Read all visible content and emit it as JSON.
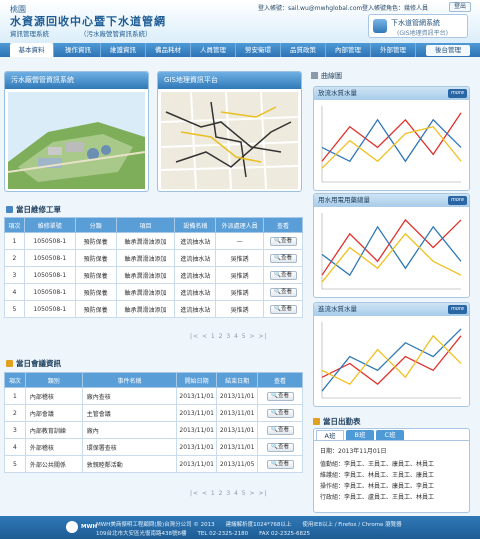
{
  "header": {
    "city": "桃園",
    "title": "水資源回收中心暨下水道管網",
    "subtitle": "資訊管理系統",
    "subtitle_en": "（污水廠營管資訊系統）",
    "login_account": "登入帳號：sail.wu@mwhglobal.com",
    "login_role": "登入帳號角色：幾修人員",
    "logout": "登出",
    "sys_badge_title": "下水道管網系統",
    "sys_badge_sub": "(GIS地理資訊平台)"
  },
  "nav": {
    "items": [
      "基本資料",
      "操作資訊",
      "維護資訊",
      "備品耗材",
      "人員管理",
      "勞安衛環",
      "品質政策",
      "內部管理",
      "外部管理"
    ],
    "right": "後台管理"
  },
  "cards": [
    {
      "title": "污水廠營管資訊系統"
    },
    {
      "title": "GIS地理資訊平台"
    }
  ],
  "repair": {
    "title": "當日維修工單",
    "headers": [
      "項次",
      "維修單號",
      "分類",
      "項目",
      "設備名稱",
      "外派處理人員",
      "查看"
    ],
    "rows": [
      [
        "1",
        "1050508-1",
        "預防保養",
        "軸承潤滑油添加",
        "進流抽水站",
        "—"
      ],
      [
        "2",
        "1050508-1",
        "預防保養",
        "軸承潤滑油添加",
        "進流抽水站",
        "吳惟誘"
      ],
      [
        "3",
        "1050508-1",
        "預防保養",
        "軸承潤滑油添加",
        "進流抽水站",
        "吳惟誘"
      ],
      [
        "4",
        "1050508-1",
        "預防保養",
        "軸承潤滑油添加",
        "進流抽水站",
        "吳惟誘"
      ],
      [
        "5",
        "1050508-1",
        "預防保養",
        "軸承潤滑油添加",
        "進流抽水站",
        "吳惟誘"
      ]
    ],
    "view_label": "查看",
    "pager": "|< < 1 2 3 4 5 > >|"
  },
  "meeting": {
    "title": "當日會議資訊",
    "headers": [
      "項次",
      "類別",
      "事件名稱",
      "開始日期",
      "結束日期",
      "查看"
    ],
    "rows": [
      [
        "1",
        "內部稽核",
        "廠內查核",
        "2013/11/01",
        "2013/11/01"
      ],
      [
        "2",
        "內部會議",
        "主管會議",
        "2013/11/01",
        "2013/11/01"
      ],
      [
        "3",
        "內部教育訓練",
        "廠內",
        "2013/11/01",
        "2013/11/01"
      ],
      [
        "4",
        "外部稽核",
        "環保署查核",
        "2013/11/01",
        "2013/11/01"
      ],
      [
        "5",
        "外部公共關係",
        "敦親睦鄰活動",
        "2013/11/01",
        "2013/11/05"
      ]
    ],
    "view_label": "查看",
    "pager": "|< < 1 2 3 4 5 > >|"
  },
  "right": {
    "title": "曲線圖",
    "more": "more",
    "charts": [
      {
        "title": "放流水質水量"
      },
      {
        "title": "用水用電用藥總量"
      },
      {
        "title": "進流水質水量"
      }
    ]
  },
  "shift": {
    "title": "當日出勤表",
    "tabs": [
      "A班",
      "B班",
      "C班"
    ],
    "date": "日期：2013年11月01日",
    "lines": [
      "值勤組：李員工、王員工、康員工、林員工",
      "維護組：李員工、林員工、王員工、康員工",
      "操作組：李員工、林員工、康員工、李員工",
      "行政組：李員工、盧員工、王員工、林員工"
    ]
  },
  "footer": {
    "logo": "MWH",
    "line1": "MWH美商傑明工程顧問(股)台灣分公司 © 2013　　建議解析度1024*768以上　　使用IE8以上 / Firefox / Chrome 瀏覽器",
    "line2": "109台北市大安區光復南路438號6樓　　TEL 02-2325-2180　　FAX 02-2325-6825"
  },
  "chart_data": [
    {
      "type": "line",
      "x": [
        1,
        2,
        3,
        4,
        5,
        6
      ],
      "series": [
        {
          "values": [
            3,
            8,
            5,
            9,
            4,
            10
          ]
        },
        {
          "values": [
            5,
            3,
            9,
            3,
            9,
            5
          ]
        },
        {
          "values": [
            2,
            6,
            3,
            7,
            8,
            3
          ]
        }
      ],
      "ylim": [
        0,
        11
      ],
      "colors": [
        "#e0312c",
        "#2f78b7",
        "#f0c020"
      ]
    },
    {
      "type": "line",
      "x": [
        1,
        2,
        3,
        4,
        5,
        6
      ],
      "series": [
        {
          "values": [
            2,
            8,
            4,
            10,
            6,
            10
          ]
        },
        {
          "values": [
            5,
            2,
            9,
            3,
            9,
            4
          ]
        },
        {
          "values": [
            1,
            6,
            3,
            8,
            4,
            2
          ]
        }
      ],
      "ylim": [
        0,
        11
      ],
      "colors": [
        "#e0312c",
        "#2f78b7",
        "#f0c020"
      ]
    },
    {
      "type": "line",
      "x": [
        1,
        2,
        3,
        4,
        5,
        6
      ],
      "series": [
        {
          "values": [
            3,
            5,
            2,
            6,
            4,
            9
          ]
        },
        {
          "values": [
            1,
            6,
            4,
            8,
            6,
            10
          ]
        },
        {
          "values": [
            4,
            2,
            7,
            3,
            9,
            5
          ]
        }
      ],
      "ylim": [
        0,
        11
      ],
      "colors": [
        "#e0312c",
        "#2f78b7",
        "#f0c020"
      ]
    }
  ]
}
